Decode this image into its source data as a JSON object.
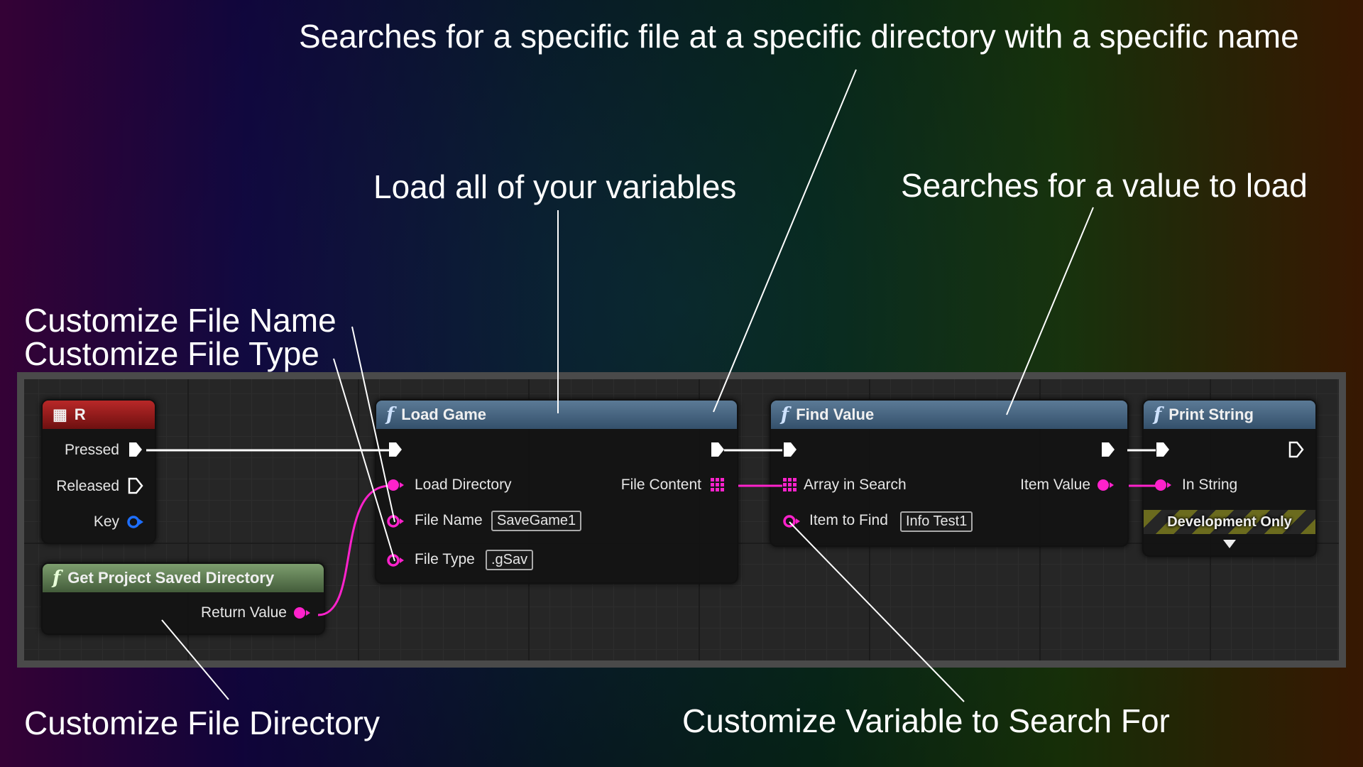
{
  "annotations": {
    "search_file": "Searches for a specific file at a specific directory with a specific name",
    "load_vars": "Load all of your variables",
    "search_value": "Searches for a value to load",
    "file_name": "Customize File Name",
    "file_type": "Customize File Type",
    "file_dir": "Customize File Directory",
    "search_var": "Customize Variable to Search For"
  },
  "nodes": {
    "key_event": {
      "title": "R",
      "pins": {
        "pressed": "Pressed",
        "released": "Released",
        "key": "Key"
      }
    },
    "load_game": {
      "title": "Load Game",
      "pins": {
        "load_directory": "Load Directory",
        "file_name": "File Name",
        "file_type": "File Type",
        "file_content": "File Content"
      },
      "fields": {
        "file_name": "SaveGame1",
        "file_type": ".gSav"
      }
    },
    "find_value": {
      "title": "Find Value",
      "pins": {
        "array_in_search": "Array in Search",
        "item_to_find": "Item to Find",
        "item_value": "Item Value"
      },
      "fields": {
        "item_to_find": "Info Test1"
      }
    },
    "print_string": {
      "title": "Print String",
      "pins": {
        "in_string": "In String"
      },
      "banner": "Development Only"
    },
    "get_saved_dir": {
      "title": "Get Project Saved Directory",
      "pins": {
        "return_value": "Return Value"
      }
    }
  },
  "colors": {
    "exec": "#ffffff",
    "string_pin": "#ff22cc",
    "key_pin": "#1e6fff",
    "function_header": "#3f5d7a",
    "event_header": "#9a1c1c",
    "pure_header": "#5f7d50",
    "callout_line": "#ffffff"
  }
}
